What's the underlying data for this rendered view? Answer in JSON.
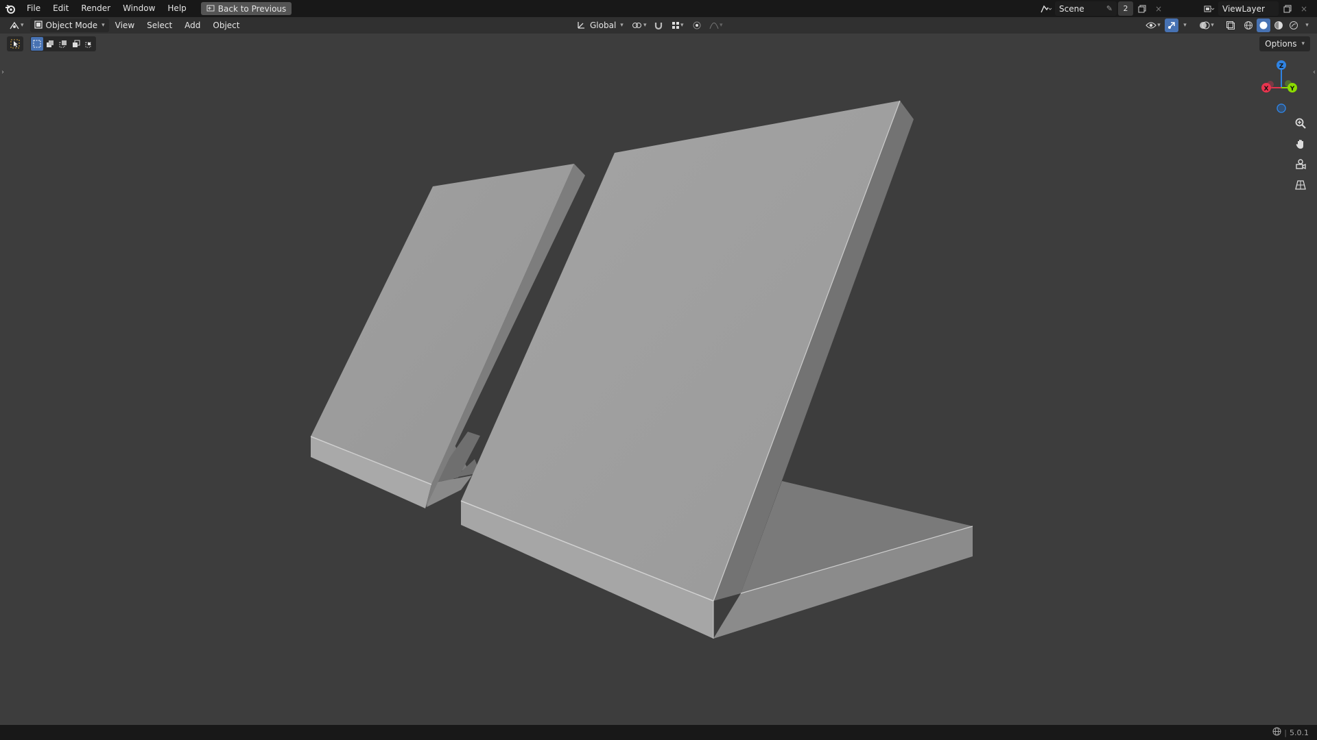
{
  "topbar": {
    "menu": [
      "File",
      "Edit",
      "Render",
      "Window",
      "Help"
    ],
    "back_label": "Back to Previous",
    "scene_name": "Scene",
    "scene_count": "2",
    "view_layer": "ViewLayer"
  },
  "viewport_header": {
    "mode": "Object Mode",
    "menus": [
      "View",
      "Select",
      "Add",
      "Object"
    ],
    "transform_orientation": "Global"
  },
  "options_label": "Options",
  "gizmo": {
    "x": "X",
    "y": "Y",
    "z": "Z"
  },
  "statusbar": {
    "version": "5.0.1"
  },
  "colors": {
    "background": "#3d3d3d",
    "header": "#303030",
    "topbar": "#181818",
    "accent": "#4772b3",
    "axis_x": "#e8344e",
    "axis_y": "#8bdc00",
    "axis_z": "#2f83e3",
    "mesh_light": "#a2a2a2",
    "mesh_dark": "#767676"
  }
}
